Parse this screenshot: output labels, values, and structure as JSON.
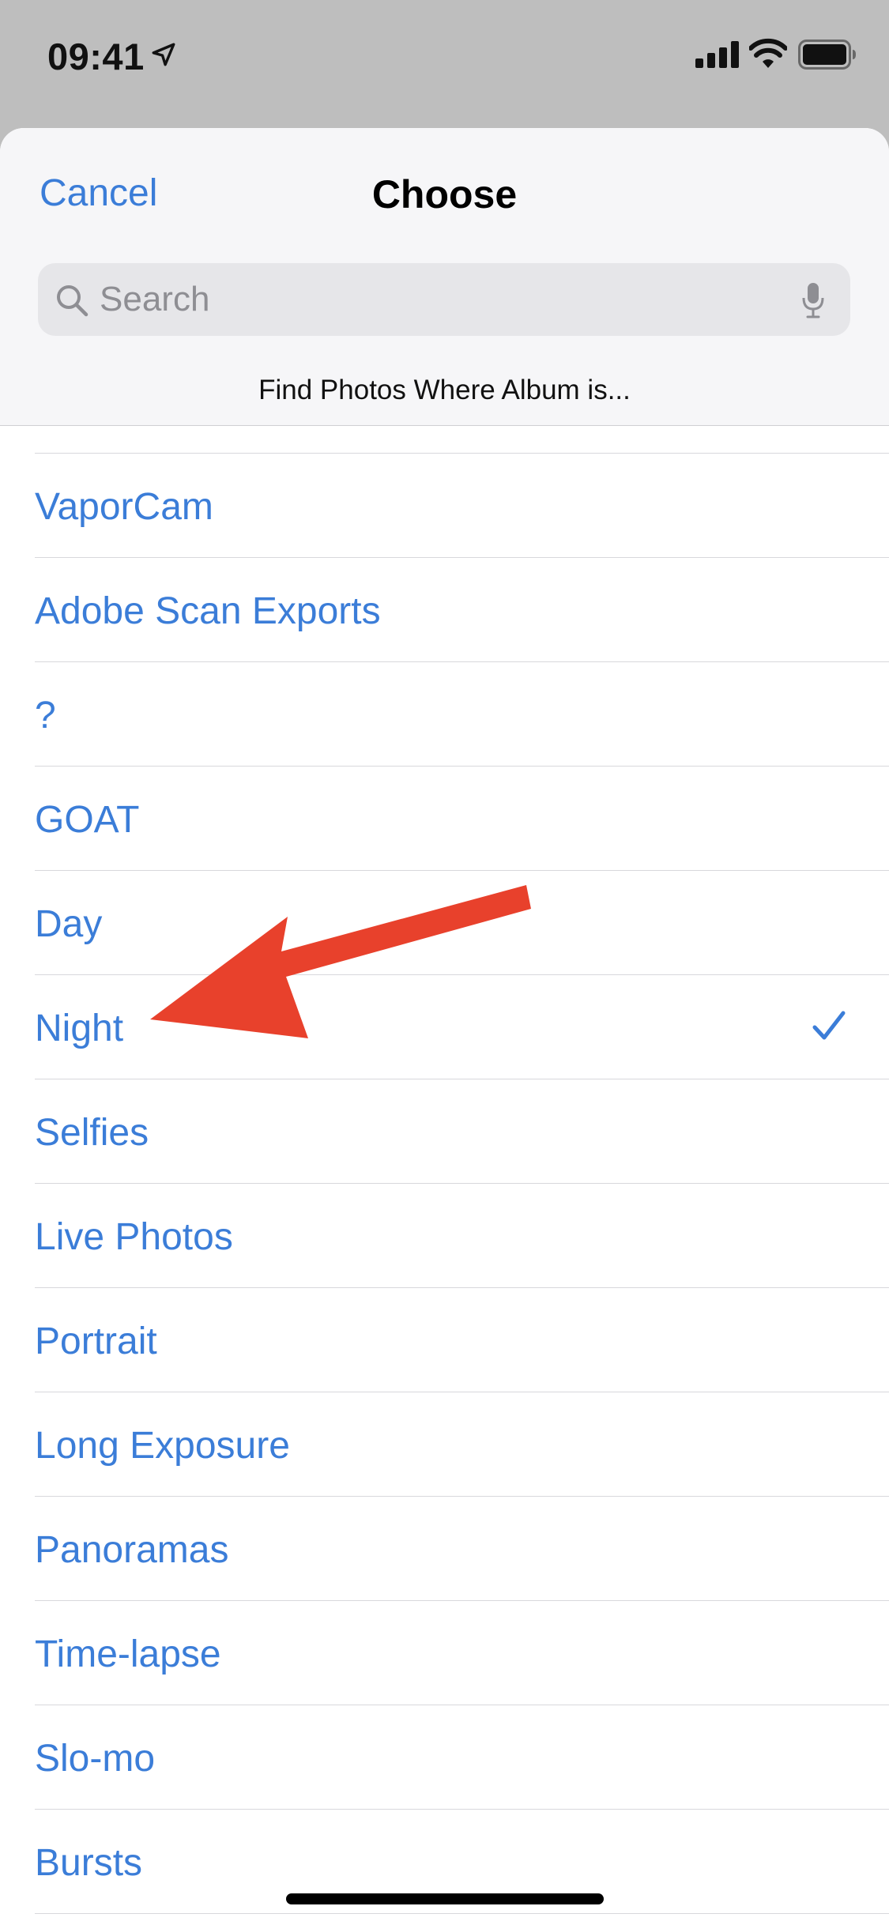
{
  "status": {
    "time": "09:41",
    "icons": [
      "location-arrow-icon",
      "cellular-signal-icon",
      "wifi-icon",
      "battery-icon"
    ]
  },
  "header": {
    "cancel_label": "Cancel",
    "title": "Choose",
    "subtitle": "Find Photos Where Album is..."
  },
  "search": {
    "placeholder": "Search",
    "value": ""
  },
  "albums": [
    {
      "label": "VaporCam",
      "selected": false
    },
    {
      "label": "Adobe Scan Exports",
      "selected": false
    },
    {
      "label": "?",
      "selected": false
    },
    {
      "label": "GOAT",
      "selected": false
    },
    {
      "label": "Day",
      "selected": false
    },
    {
      "label": "Night",
      "selected": true
    },
    {
      "label": "Selfies",
      "selected": false
    },
    {
      "label": "Live Photos",
      "selected": false
    },
    {
      "label": "Portrait",
      "selected": false
    },
    {
      "label": "Long Exposure",
      "selected": false
    },
    {
      "label": "Panoramas",
      "selected": false
    },
    {
      "label": "Time-lapse",
      "selected": false
    },
    {
      "label": "Slo-mo",
      "selected": false
    },
    {
      "label": "Bursts",
      "selected": false
    }
  ],
  "colors": {
    "accent": "#3b7dd8",
    "annotation_arrow": "#e8412c",
    "header_bg": "#f6f6f8",
    "backdrop": "#bebebe"
  }
}
